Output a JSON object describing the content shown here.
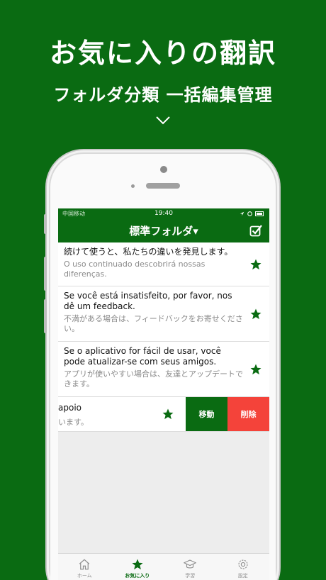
{
  "promo": {
    "title": "お気に入りの翻訳",
    "subtitle": "フォルダ分類 一括編集管理"
  },
  "statusbar": {
    "carrier": "中国移动",
    "time": "19:40"
  },
  "navbar": {
    "title": "標準フォルダ▾"
  },
  "list": {
    "items": [
      {
        "primary": "続けて使うと、私たちの違いを発見します。",
        "secondary": "O uso continuado descobrirá nossas diferenças."
      },
      {
        "primary": "Se você está insatisfeito, por favor, nos dê um feedback.",
        "secondary": "不満がある場合は、フィードバックをお寄せください。"
      },
      {
        "primary": "Se o aplicativo for fácil de usar, você pode atualizar-se com seus amigos.",
        "secondary": "アプリが使いやすい場合は、友達とアップデートできます。"
      }
    ],
    "swiped_item": {
      "primary": "apoio",
      "secondary": "います。"
    }
  },
  "actions": {
    "move": "移動",
    "delete": "削除"
  },
  "tabbar": {
    "tabs": [
      {
        "label": "ホーム",
        "icon": "home-icon",
        "active": false
      },
      {
        "label": "お気に入り",
        "icon": "star-icon",
        "active": true
      },
      {
        "label": "学習",
        "icon": "graduation-cap-icon",
        "active": false
      },
      {
        "label": "設定",
        "icon": "gear-icon",
        "active": false
      }
    ]
  },
  "colors": {
    "brand_green": "#0a6b12",
    "delete_red": "#f4433a"
  }
}
